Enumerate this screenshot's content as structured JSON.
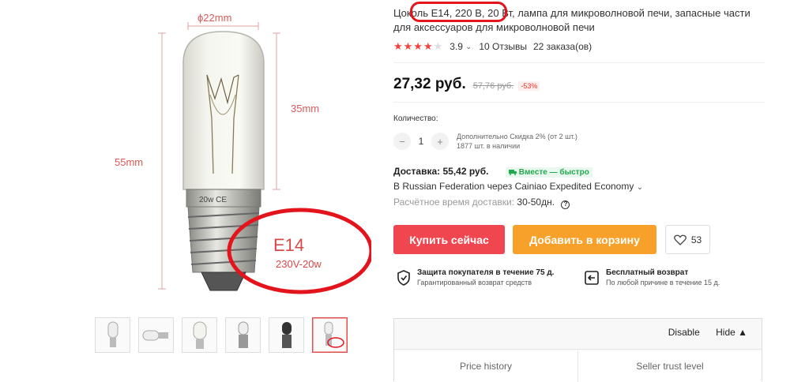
{
  "gallery": {
    "image": {
      "diameter_label": "ϕ22mm",
      "bulb_height_label": "35mm",
      "total_height_label": "55mm",
      "base_label": "E14",
      "spec_label": "230V-20w"
    },
    "thumbnails": 6,
    "active_thumbnail": 6
  },
  "product": {
    "title": "Цоколь E14, 220 В, 20 Вт, лампа для микроволновой печи, запасные части для аксессуаров для микроволновой печи",
    "rating": "3.9",
    "rating_stars_filled": 4,
    "reviews": "10 Отзывы",
    "orders": "22 заказа(ов)",
    "price": "27,32 руб.",
    "old_price": "57,76 руб.",
    "discount": "-53%"
  },
  "quantity": {
    "label": "Количество:",
    "minus": "−",
    "value": "1",
    "plus": "+",
    "note_line1": "Дополнительно Скидка 2% (от 2 шт.)",
    "note_line2": "1877 шт. в наличии"
  },
  "delivery": {
    "title": "Доставка: 55,42 руб.",
    "badge": "Вместе — быстро",
    "route": "В Russian Federation через Cainiao Expedited Economy",
    "eta_label": "Расчётное время доставки:",
    "eta_value": "30-50дн.",
    "help": "?"
  },
  "actions": {
    "buy_now": "Купить сейчас",
    "add_to_cart": "Добавить в корзину",
    "wishlist_count": "53"
  },
  "guarantees": [
    {
      "title": "Защита покупателя в течение 75 д.",
      "subtitle": "Гарантированный возврат средств"
    },
    {
      "title": "Бесплатный возврат",
      "subtitle": "По любой причине в течение 15 д."
    }
  ],
  "extension_panel": {
    "disable": "Disable",
    "hide": "Hide ▲",
    "tabs": [
      "Price history",
      "Seller trust level"
    ]
  },
  "colors": {
    "buy": "#f0464f",
    "cart": "#f8a12a",
    "price_red": "#e8372c",
    "annotation_red": "#e3141c",
    "fast_green": "#21a94e"
  }
}
